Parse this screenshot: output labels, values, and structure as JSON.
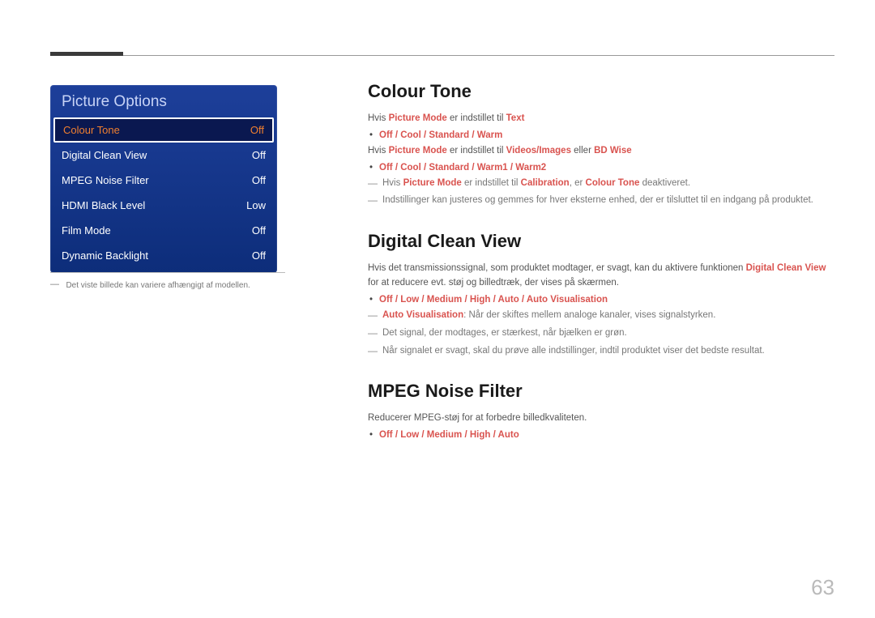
{
  "pageNumber": "63",
  "panel": {
    "title": "Picture Options",
    "rows": [
      {
        "label": "Colour Tone",
        "value": "Off",
        "selected": true
      },
      {
        "label": "Digital Clean View",
        "value": "Off",
        "selected": false
      },
      {
        "label": "MPEG Noise Filter",
        "value": "Off",
        "selected": false
      },
      {
        "label": "HDMI Black Level",
        "value": "Low",
        "selected": false
      },
      {
        "label": "Film Mode",
        "value": "Off",
        "selected": false
      },
      {
        "label": "Dynamic Backlight",
        "value": "Off",
        "selected": false
      }
    ],
    "footnote": "Det viste billede kan variere afhængigt af modellen."
  },
  "sections": {
    "colourTone": {
      "heading": "Colour Tone",
      "line1_a": "Hvis ",
      "line1_b": "Picture Mode",
      "line1_c": " er indstillet til ",
      "line1_d": "Text",
      "bullet1": "Off / Cool / Standard / Warm",
      "line2_a": "Hvis ",
      "line2_b": "Picture Mode",
      "line2_c": " er indstillet til ",
      "line2_d": "Videos/Images",
      "line2_e": " eller ",
      "line2_f": "BD Wise",
      "bullet2": "Off / Cool / Standard / Warm1 / Warm2",
      "dash1_a": "Hvis ",
      "dash1_b": "Picture Mode",
      "dash1_c": " er indstillet til ",
      "dash1_d": "Calibration",
      "dash1_e": ", er ",
      "dash1_f": "Colour Tone",
      "dash1_g": " deaktiveret.",
      "dash2": "Indstillinger kan justeres og gemmes for hver eksterne enhed, der er tilsluttet til en indgang på produktet."
    },
    "dcv": {
      "heading": "Digital Clean View",
      "intro_a": "Hvis det transmissionssignal, som produktet modtager, er svagt, kan du aktivere funktionen ",
      "intro_b": "Digital Clean View",
      "intro_c": " for at reducere evt. støj og billedtræk, der vises på skærmen.",
      "bullet1": "Off / Low / Medium / High / Auto / Auto Visualisation",
      "dash1_a": "Auto Visualisation",
      "dash1_b": ": Når der skiftes mellem analoge kanaler, vises signalstyrken.",
      "dash2": "Det signal, der modtages, er stærkest, når bjælken er grøn.",
      "dash3": "Når signalet er svagt, skal du prøve alle indstillinger, indtil produktet viser det bedste resultat."
    },
    "mpeg": {
      "heading": "MPEG Noise Filter",
      "intro": "Reducerer MPEG-støj for at forbedre billedkvaliteten.",
      "bullet1": "Off / Low / Medium / High / Auto"
    }
  }
}
